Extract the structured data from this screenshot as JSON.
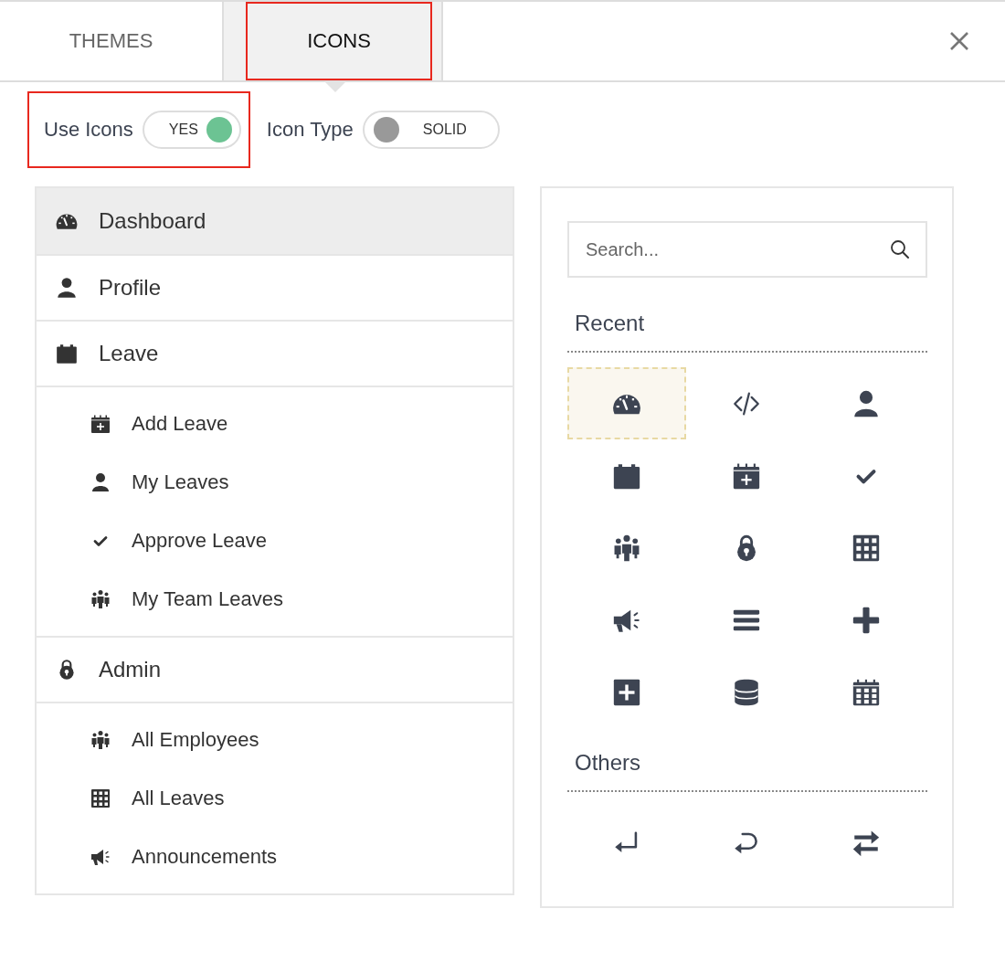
{
  "tabs": [
    {
      "label": "THEMES",
      "selected": false,
      "highlighted": false
    },
    {
      "label": "ICONS",
      "selected": true,
      "highlighted": true
    }
  ],
  "settings": [
    {
      "label": "Use Icons",
      "value": "YES",
      "on": true,
      "highlighted": true
    },
    {
      "label": "Icon Type",
      "value": "SOLID",
      "on": false,
      "highlighted": false
    }
  ],
  "menu": [
    {
      "label": "Dashboard",
      "selected": true
    },
    {
      "label": "Profile",
      "selected": false
    },
    {
      "label": "Leave",
      "selected": false,
      "children": [
        {
          "label": "Add Leave",
          "selected": false
        },
        {
          "label": "My Leaves",
          "selected": false
        },
        {
          "label": "Approve Leave",
          "selected": false
        },
        {
          "label": "My Team Leaves",
          "selected": false
        }
      ]
    },
    {
      "label": "Admin",
      "selected": false,
      "children": [
        {
          "label": "All Employees",
          "selected": false
        },
        {
          "label": "All Leaves",
          "selected": false
        },
        {
          "label": "Announcements",
          "selected": false
        }
      ]
    }
  ],
  "icon_picker": {
    "search": {
      "placeholder": "Search..."
    },
    "sections": [
      {
        "title": "Recent",
        "icons": [
          {
            "selected": true
          },
          {
            "selected": false
          },
          {
            "selected": false
          },
          {
            "selected": false
          },
          {
            "selected": false
          },
          {
            "selected": false
          },
          {
            "selected": false
          },
          {
            "selected": false
          },
          {
            "selected": false
          },
          {
            "selected": false
          },
          {
            "selected": false
          },
          {
            "selected": false
          },
          {
            "selected": false
          },
          {
            "selected": false
          },
          {
            "selected": false
          }
        ]
      },
      {
        "title": "Others",
        "icons": [
          {
            "selected": false
          },
          {
            "selected": false
          },
          {
            "selected": false
          }
        ]
      }
    ]
  }
}
